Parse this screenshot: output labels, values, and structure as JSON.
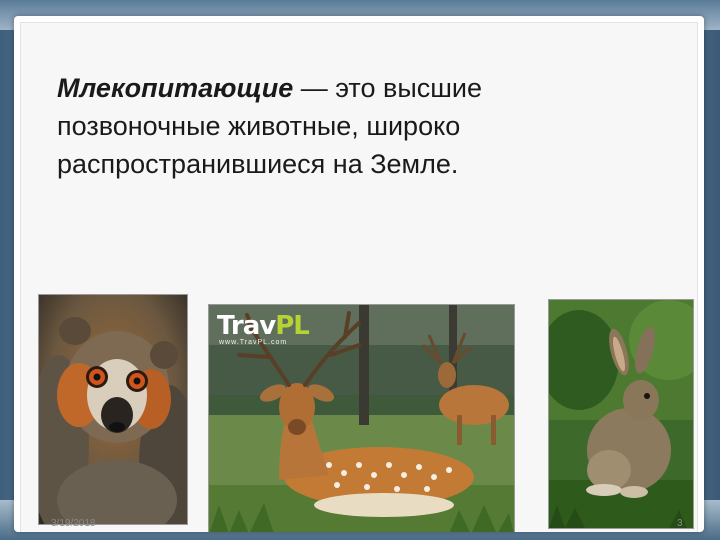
{
  "slide": {
    "definition": {
      "term": "Млекопитающие",
      "rest_line1": " — это высшие",
      "line2": "позвоночные животные, широко",
      "line3": "распространившиеся на Земле."
    },
    "footer": {
      "date": "3/19/2018",
      "page_number": "3"
    },
    "photos": [
      {
        "subject": "lemur-photo"
      },
      {
        "subject": "deer-photo",
        "watermark_main": "Trav",
        "watermark_accent": "PL",
        "watermark_url": "www.TravPL.com"
      },
      {
        "subject": "hare-photo"
      }
    ]
  }
}
